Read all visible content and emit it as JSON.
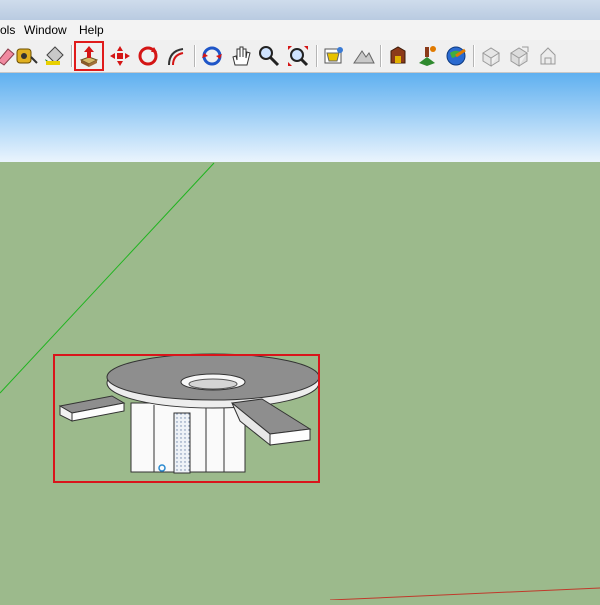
{
  "menu": {
    "tools_partial": "ols",
    "window": "Window",
    "help": "Help"
  },
  "toolbar": {
    "icons": [
      "eraser-icon",
      "tape-measure-icon",
      "paint-bucket-icon",
      "push-pull-icon",
      "move-icon",
      "rotate-icon",
      "offset-icon",
      "orbit-icon",
      "pan-icon",
      "zoom-icon",
      "zoom-extents-icon",
      "add-location-icon",
      "terrain-icon",
      "get-models-icon",
      "place-model-icon",
      "google-earth-icon",
      "component-1-icon",
      "component-2-icon",
      "component-3-icon"
    ],
    "highlighted_tool": "push-pull-icon",
    "highlight_color": "#e01b1b"
  },
  "scene": {
    "sky_color_top": "#5fb0f0",
    "sky_color_bottom": "#eaf4fd",
    "ground_color": "#9cba8c",
    "green_axis_color": "#1fb41f",
    "red_axis_color": "#c0392b",
    "model": "3d-part-with-washer-top",
    "selection_color": "#d9151b"
  }
}
